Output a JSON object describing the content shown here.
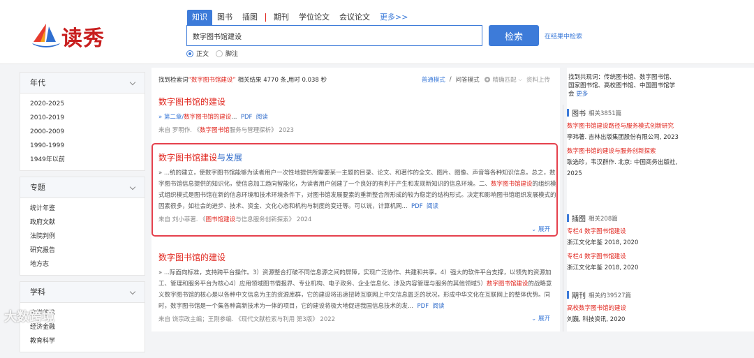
{
  "brand": {
    "logo_text": "读秀"
  },
  "tabs": [
    {
      "label": "知识",
      "active": true
    },
    {
      "label": "图书"
    },
    {
      "label": "插图"
    },
    {
      "label": "期刊"
    },
    {
      "label": "学位论文"
    },
    {
      "label": "会议论文"
    },
    {
      "label": "更多>>"
    }
  ],
  "search": {
    "value": "数字图书馆建设",
    "button": "检索",
    "in_results": "在结果中检索"
  },
  "radios": [
    {
      "label": "正文",
      "checked": true
    },
    {
      "label": "脚注",
      "checked": false
    }
  ],
  "facets": [
    {
      "title": "年代",
      "items": [
        "2020-2025",
        "2010-2019",
        "2000-2009",
        "1990-1999",
        "1949年以前"
      ]
    },
    {
      "title": "专题",
      "items": [
        "统计年鉴",
        "政府文献",
        "法院判例",
        "研究报告",
        "地方志"
      ]
    },
    {
      "title": "学科",
      "items": [
        "文学艺术",
        "经济金融",
        "教育科学"
      ]
    }
  ],
  "summary": {
    "prefix": "找到检索词",
    "term": "“数字图书馆建设”",
    "suffix": "相关结果 4770 条,用时 0.038 秒"
  },
  "modes": {
    "normal": "普通模式",
    "sep": "/",
    "qa": "问答模式",
    "match": "精确匹配",
    "upload": "资料上传"
  },
  "results": [
    {
      "title": "数字图书馆的建设",
      "snippet_a": "»  第二章/",
      "snippet_hl": "数字图书馆的建设",
      "snippet_b": "...",
      "links": [
        "PDF",
        "阅读"
      ],
      "meta_a": "来自 罗明作. 《",
      "meta_hl": "数字图书馆",
      "meta_b": "服务与管理探析》 2023"
    },
    {
      "title_hl": "数字图书馆建设",
      "title_rest": "与发展",
      "snippet_1": "» ...统的建立，使数字图书馆能够为读者用户一次性地提供所需要某一主题的目录、论文、和著作的全文、图片、图像、声音等各种知识信息。总之，数字图书馆信息提供的知识化，使信息加工趋向智能化，为读者用户创建了一个良好的有利于产生和发现新知识的信息环境。二、",
      "snippet_hl": "数字图书馆建设",
      "snippet_2": "的组织模式组织模式是图书馆在新的信息环境和技术环境条件下，对图书馆发展要素的重新整合所形成的较为稳定的结构形式。决定和影响图书馆组织发展模式的因素很多，如社会的进步、技术、资金、文化心态和机构与制度的变迁等。可以说，计算机网...",
      "links": [
        "PDF",
        "阅读"
      ],
      "meta_a": "来自 刘小菲著. 《",
      "meta_hl": "图书馆建设",
      "meta_b": "与信息服务创新探索》 2024",
      "expand": "展开"
    },
    {
      "title": "数字图书馆的建设",
      "snippet_1": "» ...际面向标准，支持跨平台操作。3）资源整合打破不同信息源之间的屏障，实现广泛协作、共建和共享。4）强大的软件平台支撑，以领先的资源加工、管理和服务平台为核心4）应用领域图书情报界、专业机构、电子政务、企业信息化、涉及内容管理与服务的其他领域5）",
      "snippet_hl": "数字图书馆建设",
      "snippet_2": "的战略意义数字图书馆的核心是以各种中文信息为主的资源库群，它的建设将迅速扭转互联网上中文信息匮乏的状况，形成中华文化在互联网上的整体优势。同时，数字图书馆是一个集各种高新技术为一体的项目，它的建设将极大地促进我国信息技术的发...",
      "links": [
        "PDF",
        "阅读"
      ],
      "meta": "来自 饶宗政主编；王刚参编. 《现代文献检索与利用 第3版》 2022",
      "expand": "展开"
    }
  ],
  "right": {
    "co_label": "找到共现词：",
    "co_words": "传统图书馆、数字图书馆、国家图书馆、高校图书馆、中国图书馆学会",
    "co_more": "更多",
    "books": {
      "title": "图书",
      "count": "相关3851篇",
      "items": [
        {
          "hl": "数字图书馆建设",
          "rest": "路径与服务模式创新研究",
          "meta": "李玮著. 吉林出版集团股份有限公司, 2023"
        },
        {
          "hl": "数字图书馆",
          "rest": "的建设与服务创新探索",
          "meta": "耿选珍，韦汉群作. 北京: 中国商务出版社, 2025"
        }
      ]
    },
    "illustrations": {
      "title": "插图",
      "count": "相关208篇",
      "items": [
        {
          "pre": "专栏4 ",
          "hl": "数字图书馆建设",
          "meta": "浙江文化年鉴 2018, 2020"
        },
        {
          "pre": "专栏4 ",
          "hl": "数字图书馆建设",
          "meta": "浙江文化年鉴 2018, 2020"
        }
      ]
    },
    "journals": {
      "title": "期刊",
      "count": "相关约39527篇",
      "items": [
        {
          "pre": "高校",
          "hl": "数字图书馆",
          "rest": "的建设",
          "meta": "刘巍, 科技资讯, 2020"
        }
      ]
    }
  },
  "watermark": "大数跨境"
}
